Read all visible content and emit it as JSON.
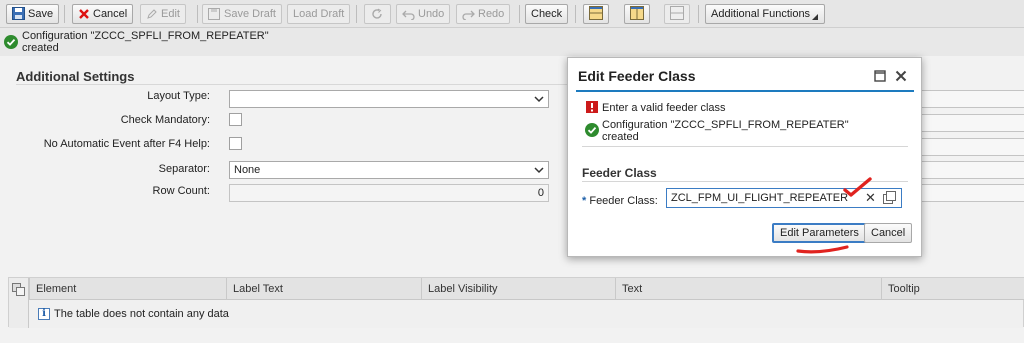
{
  "toolbar": {
    "save": "Save",
    "cancel": "Cancel",
    "edit": "Edit",
    "save_draft": "Save Draft",
    "load_draft": "Load Draft",
    "undo": "Undo",
    "redo": "Redo",
    "check": "Check",
    "additional_functions": "Additional Functions"
  },
  "message": {
    "line1": "Configuration \"ZCCC_SPFLI_FROM_REPEATER\"",
    "line2": "created"
  },
  "settings": {
    "title": "Additional Settings",
    "layout_type_label": "Layout Type:",
    "layout_type_value": "",
    "check_mandatory_label": "Check Mandatory:",
    "no_auto_event_label": "No Automatic Event after F4 Help:",
    "separator_label": "Separator:",
    "separator_value": "None",
    "row_count_label": "Row Count:",
    "row_count_value": "0"
  },
  "table": {
    "columns": [
      "Element",
      "Label Text",
      "Label Visibility",
      "Text",
      "Tooltip"
    ],
    "empty_text": "The table does not contain any data"
  },
  "dialog": {
    "title": "Edit Feeder Class",
    "error_msg": "Enter a valid feeder class",
    "success_line1": "Configuration \"ZCCC_SPFLI_FROM_REPEATER\"",
    "success_line2": "created",
    "section_title": "Feeder Class",
    "required_marker": "*",
    "feeder_label": "Feeder Class:",
    "feeder_value": "ZCL_FPM_UI_FLIGHT_REPEATER",
    "clear_glyph": "✕",
    "edit_params": "Edit Parameters",
    "cancel": "Cancel"
  },
  "colors": {
    "accent": "#1d7bbf",
    "success": "#2e8b2e",
    "error": "#cc1a1a",
    "annotation": "#e0231f"
  }
}
